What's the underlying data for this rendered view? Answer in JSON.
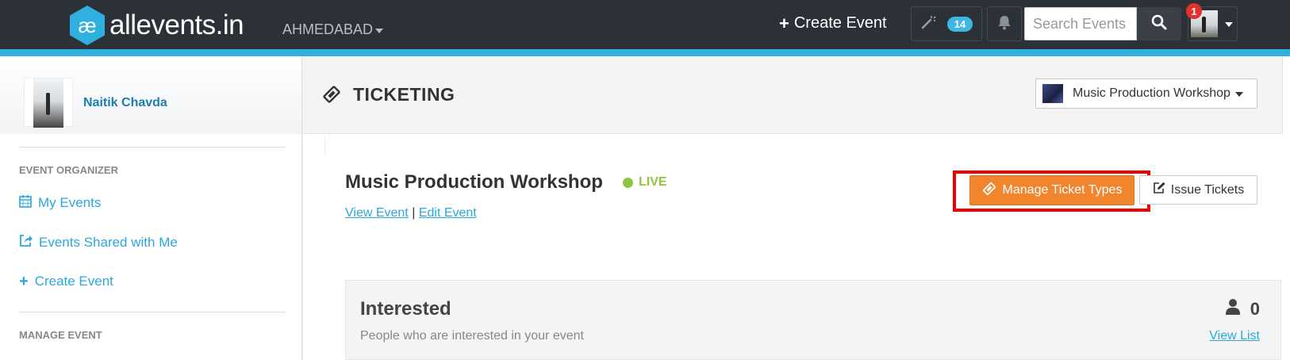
{
  "navbar": {
    "logo_text": "allevents.in",
    "city": "AHMEDABAD",
    "create_event": "Create Event",
    "wand_count": "14",
    "search_placeholder": "Search Events",
    "notification_count": "1",
    "colors": {
      "bar": "#2c3138",
      "stripe": "#2fb0df",
      "badge": "#3fb7e3",
      "alert": "#e0312d"
    }
  },
  "sidebar": {
    "user_name": "Naitik Chavda",
    "sections": [
      {
        "heading": "EVENT ORGANIZER",
        "items": [
          {
            "label": "My Events",
            "icon": "calendar-icon"
          },
          {
            "label": "Events Shared with Me",
            "icon": "share-icon"
          },
          {
            "label": "Create Event",
            "icon": "plus-icon"
          }
        ]
      },
      {
        "heading": "MANAGE EVENT",
        "items": []
      }
    ]
  },
  "main": {
    "page_title": "TICKETING",
    "event_selector": "Music Production Workshop",
    "event": {
      "title": "Music Production Workshop",
      "status": "LIVE",
      "view_link": "View Event",
      "separator": "|",
      "edit_link": "Edit Event"
    },
    "actions": {
      "manage_tickets": "Manage Ticket Types",
      "issue_tickets": "Issue Tickets"
    },
    "interested_card": {
      "title": "Interested",
      "description": "People who are interested in your event",
      "count": "0",
      "link": "View List"
    },
    "colors": {
      "live": "#8cc63f",
      "primary_button": "#f0852d",
      "link": "#2aa8dd",
      "highlight": "#ee0000"
    }
  }
}
